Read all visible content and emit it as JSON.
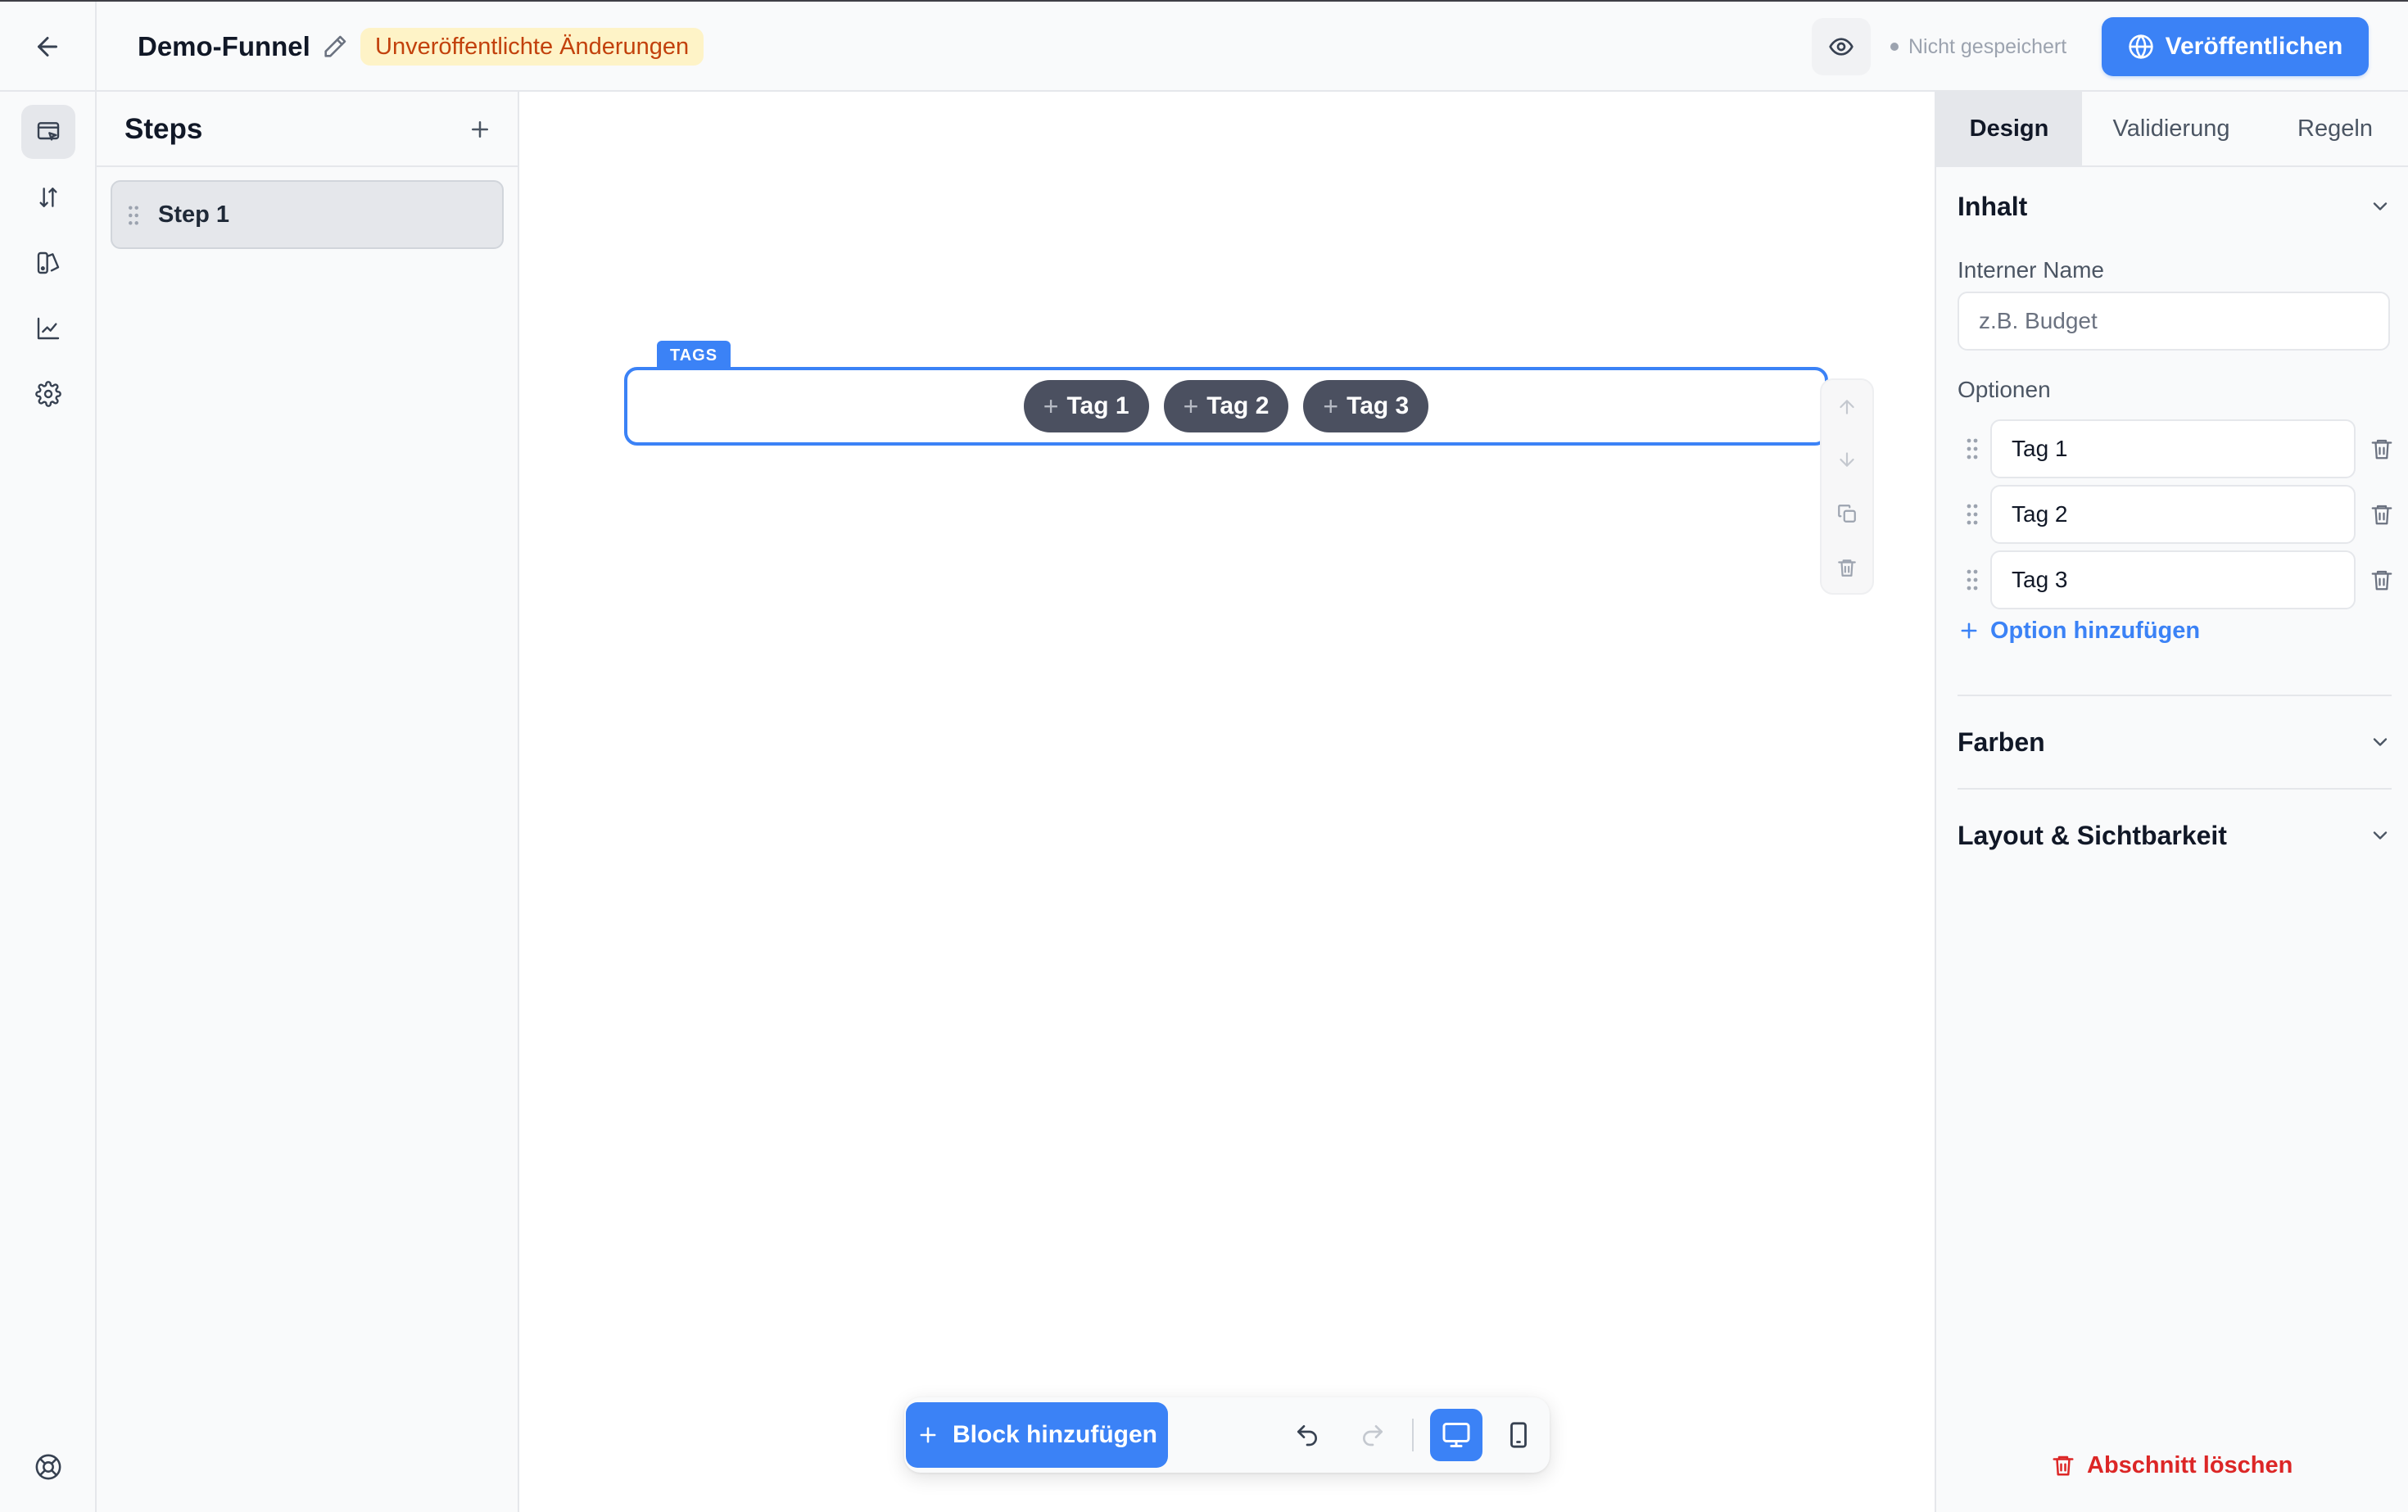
{
  "header": {
    "funnel_name": "Demo-Funnel",
    "unsaved_badge": "Unveröffentlichte Änderungen",
    "save_status": "Nicht gespeichert",
    "publish_label": "Veröffentlichen"
  },
  "rail": {
    "items": [
      "funnel-editor-icon",
      "sort-icon",
      "theme-icon",
      "analytics-icon",
      "settings-icon"
    ],
    "bottom_item": "help-icon"
  },
  "steps": {
    "title": "Steps",
    "items": [
      {
        "label": "Step 1",
        "selected": true
      }
    ]
  },
  "canvas": {
    "block_type": "TAGS",
    "tags": [
      "Tag 1",
      "Tag 2",
      "Tag 3"
    ]
  },
  "toolbar": {
    "add_block_label": "Block hinzufügen",
    "active_device": "desktop"
  },
  "settings": {
    "tabs": [
      "Design",
      "Validierung",
      "Regeln"
    ],
    "active_tab": "Design",
    "content_section": {
      "title": "Inhalt",
      "internal_name_label": "Interner Name",
      "internal_name_placeholder": "z.B. Budget",
      "internal_name_value": "",
      "options_label": "Optionen",
      "options": [
        "Tag 1",
        "Tag 2",
        "Tag 3"
      ],
      "add_option_label": "Option hinzufügen"
    },
    "colors_section": {
      "title": "Farben"
    },
    "layout_section": {
      "title": "Layout & Sichtbarkeit"
    },
    "delete_section_label": "Abschnitt löschen"
  },
  "colors": {
    "accent": "#3b82f6",
    "chip": "#4b5060",
    "danger": "#dc2626",
    "badge_bg": "#fef3c7",
    "badge_text": "#c2410c"
  }
}
